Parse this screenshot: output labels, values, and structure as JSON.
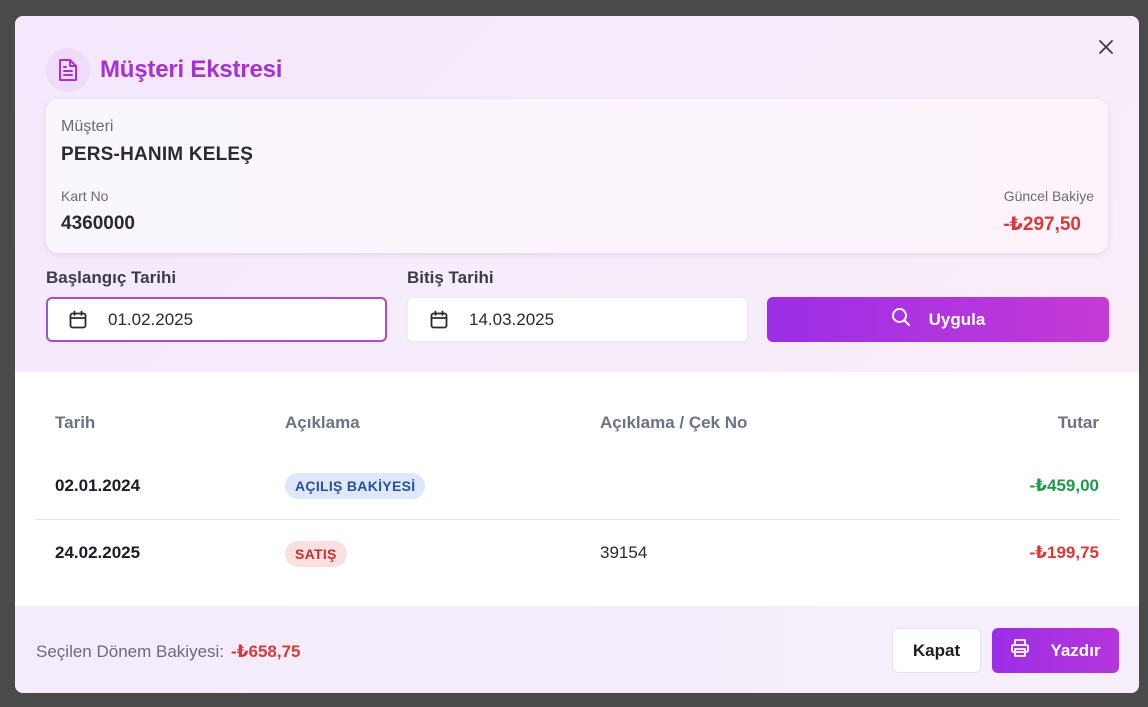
{
  "modal": {
    "title": "Müşteri Ekstresi",
    "icon": "document-icon"
  },
  "customer": {
    "label": "Müşteri",
    "name": "PERS-HANIM KELEŞ",
    "card_label": "Kart No",
    "card_no": "4360000",
    "balance_label": "Güncel Bakiye",
    "balance": "-₺297,50"
  },
  "filters": {
    "start_label": "Başlangıç Tarihi",
    "start_value": "01.02.2025",
    "end_label": "Bitiş Tarihi",
    "end_value": "14.03.2025",
    "apply_label": "Uygula"
  },
  "table": {
    "headers": [
      "Tarih",
      "Açıklama",
      "Açıklama / Çek No",
      "Tutar"
    ],
    "rows": [
      {
        "date": "02.01.2024",
        "type": "AÇILIŞ BAKİYESİ",
        "note": "",
        "amount": "-₺459,00"
      },
      {
        "date": "24.02.2025",
        "type": "SATIŞ",
        "note": "39154",
        "amount": "-₺199,75"
      }
    ]
  },
  "footer": {
    "period_label": "Seçilen Dönem Bakiyesi:",
    "period_balance": "-₺658,75",
    "close_label": "Kapat",
    "print_label": "Yazdır"
  },
  "colors": {
    "accent": "#a830d8",
    "negative": "#d63b3b",
    "positive": "#1f9a4d"
  }
}
